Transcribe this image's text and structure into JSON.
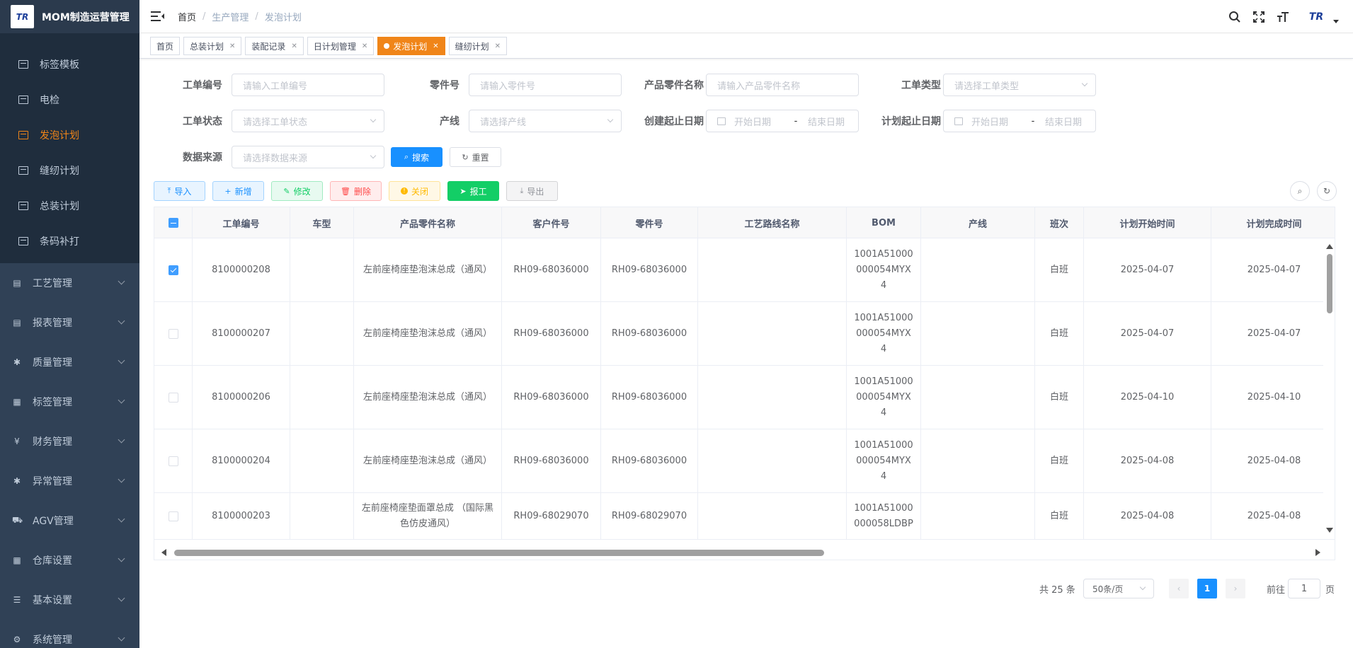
{
  "app": {
    "logo_text": "TR",
    "title": "MOM制造运营管理"
  },
  "sidebar": {
    "submenu": [
      {
        "label": "标签模板",
        "active": false
      },
      {
        "label": "电检",
        "active": false
      },
      {
        "label": "发泡计划",
        "active": true
      },
      {
        "label": "缝纫计划",
        "active": false
      },
      {
        "label": "总装计划",
        "active": false
      },
      {
        "label": "条码补打",
        "active": false
      }
    ],
    "menus": [
      {
        "label": "工艺管理",
        "icon": "▤"
      },
      {
        "label": "报表管理",
        "icon": "▤"
      },
      {
        "label": "质量管理",
        "icon": "✱"
      },
      {
        "label": "标签管理",
        "icon": "▦"
      },
      {
        "label": "财务管理",
        "icon": "¥"
      },
      {
        "label": "异常管理",
        "icon": "✱"
      },
      {
        "label": "AGV管理",
        "icon": "⛟"
      },
      {
        "label": "仓库设置",
        "icon": "▦"
      },
      {
        "label": "基本设置",
        "icon": "☰"
      },
      {
        "label": "系统管理",
        "icon": "⚙"
      }
    ]
  },
  "header": {
    "breadcrumb": [
      "首页",
      "生产管理",
      "发泡计划"
    ],
    "avatar_text": "TR"
  },
  "tabs": [
    {
      "label": "首页",
      "closable": false,
      "active": false
    },
    {
      "label": "总装计划",
      "closable": true,
      "active": false
    },
    {
      "label": "装配记录",
      "closable": true,
      "active": false
    },
    {
      "label": "日计划管理",
      "closable": true,
      "active": false
    },
    {
      "label": "发泡计划",
      "closable": true,
      "active": true
    },
    {
      "label": "缝纫计划",
      "closable": true,
      "active": false
    }
  ],
  "filters": {
    "order_no": {
      "label": "工单编号",
      "placeholder": "请输入工单编号"
    },
    "part_no": {
      "label": "零件号",
      "placeholder": "请输入零件号"
    },
    "part_name": {
      "label": "产品零件名称",
      "placeholder": "请输入产品零件名称"
    },
    "order_type": {
      "label": "工单类型",
      "placeholder": "请选择工单类型"
    },
    "order_status": {
      "label": "工单状态",
      "placeholder": "请选择工单状态"
    },
    "line": {
      "label": "产线",
      "placeholder": "请选择产线"
    },
    "create_range": {
      "label": "创建起止日期",
      "start": "开始日期",
      "sep": "-",
      "end": "结束日期"
    },
    "plan_range": {
      "label": "计划起止日期",
      "start": "开始日期",
      "sep": "-",
      "end": "结束日期"
    },
    "source": {
      "label": "数据来源",
      "placeholder": "请选择数据来源"
    },
    "search_label": "搜索",
    "reset_label": "重置"
  },
  "toolbar": {
    "import": "导入",
    "add": "新增",
    "edit": "修改",
    "delete": "删除",
    "close": "关闭",
    "report": "报工",
    "export": "导出"
  },
  "colors": {
    "accent": "#f08519",
    "primary": "#1890ff",
    "success": "#13ce66",
    "danger": "#ff4949",
    "warning": "#ffba00",
    "sidebar_bg": "#304156"
  },
  "table": {
    "columns": [
      "工单编号",
      "车型",
      "产品零件名称",
      "客户件号",
      "零件号",
      "工艺路线名称",
      "BOM",
      "产线",
      "班次",
      "计划开始时间",
      "计划完成时间"
    ],
    "rows": [
      {
        "checked": true,
        "order_no": "8100000208",
        "model": "",
        "part_name": "左前座椅座垫泡沫总成（通风）",
        "cust_no": "RH09-68036000",
        "part_no": "RH09-68036000",
        "route": "",
        "bom": "1001A51000000054MYX4",
        "line": "",
        "shift": "白班",
        "start": "2025-04-07",
        "end": "2025-04-07"
      },
      {
        "checked": false,
        "order_no": "8100000207",
        "model": "",
        "part_name": "左前座椅座垫泡沫总成（通风）",
        "cust_no": "RH09-68036000",
        "part_no": "RH09-68036000",
        "route": "",
        "bom": "1001A51000000054MYX4",
        "line": "",
        "shift": "白班",
        "start": "2025-04-07",
        "end": "2025-04-07"
      },
      {
        "checked": false,
        "order_no": "8100000206",
        "model": "",
        "part_name": "左前座椅座垫泡沫总成（通风）",
        "cust_no": "RH09-68036000",
        "part_no": "RH09-68036000",
        "route": "",
        "bom": "1001A51000000054MYX4",
        "line": "",
        "shift": "白班",
        "start": "2025-04-10",
        "end": "2025-04-10"
      },
      {
        "checked": false,
        "order_no": "8100000204",
        "model": "",
        "part_name": "左前座椅座垫泡沫总成（通风）",
        "cust_no": "RH09-68036000",
        "part_no": "RH09-68036000",
        "route": "",
        "bom": "1001A51000000054MYX4",
        "line": "",
        "shift": "白班",
        "start": "2025-04-08",
        "end": "2025-04-08"
      },
      {
        "checked": false,
        "order_no": "8100000203",
        "model": "",
        "part_name": "左前座椅座垫面罩总成 （国际黑色仿皮通风）",
        "cust_no": "RH09-68029070",
        "part_no": "RH09-68029070",
        "route": "",
        "bom": "1001A51000000058LDBP",
        "line": "",
        "shift": "白班",
        "start": "2025-04-08",
        "end": "2025-04-08"
      }
    ]
  },
  "pagination": {
    "total": "共 25 条",
    "page_size": "50条/页",
    "current": "1",
    "goto_prefix": "前往",
    "goto_value": "1",
    "goto_suffix": "页"
  }
}
